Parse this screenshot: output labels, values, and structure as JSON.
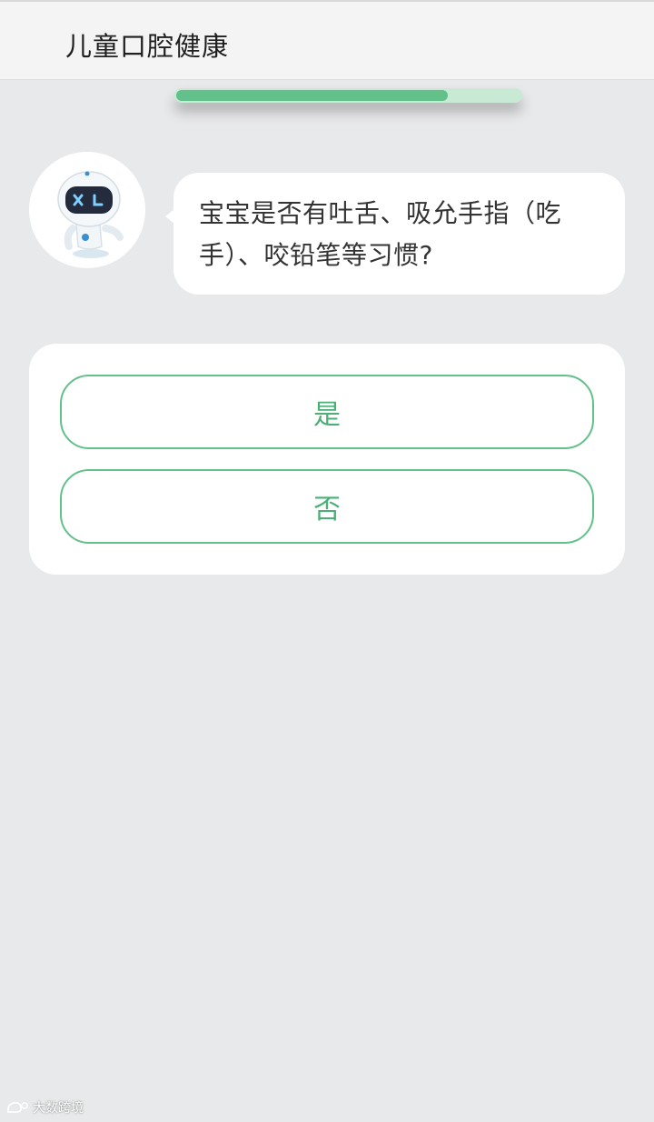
{
  "header": {
    "title": "儿童口腔健康"
  },
  "progress": {
    "fraction": 0.79,
    "fill_color": "#62c08a",
    "track_color": "#c8ead4"
  },
  "chat": {
    "avatar_icon": "robot-mascot-icon",
    "question": "宝宝是否有吐舌、吸允手指（吃手）、咬铅笔等习惯?"
  },
  "answers": [
    {
      "label": "是"
    },
    {
      "label": "否"
    }
  ],
  "watermark": {
    "text": "大数跨境",
    "icon": "brand-logo-icon"
  },
  "colors": {
    "accent": "#62c08a",
    "background": "#e8e9ea"
  }
}
